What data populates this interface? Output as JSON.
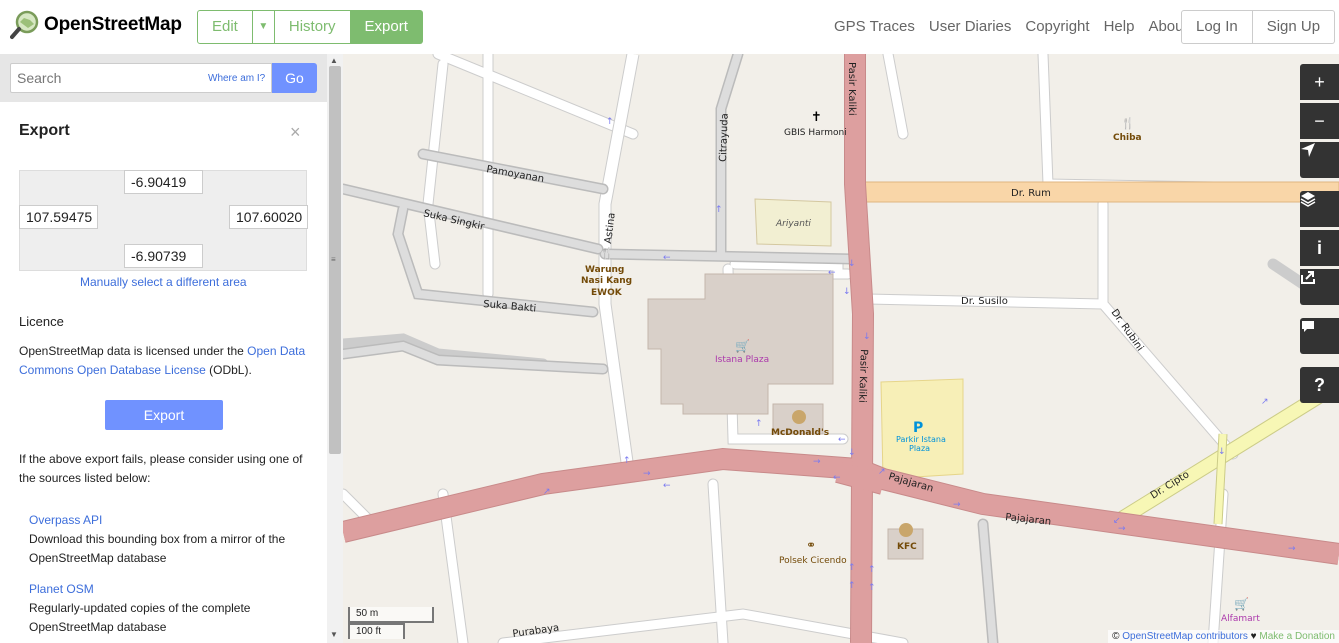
{
  "header": {
    "title": "OpenStreetMap",
    "edit_label": "Edit",
    "history_label": "History",
    "export_label": "Export",
    "nav": [
      "GPS Traces",
      "User Diaries",
      "Copyright",
      "Help",
      "About"
    ],
    "login_label": "Log In",
    "signup_label": "Sign Up"
  },
  "search": {
    "placeholder": "Search",
    "where_am_i": "Where am I?",
    "go_label": "Go"
  },
  "export": {
    "title": "Export",
    "close": "×",
    "bbox": {
      "top": "-6.90419",
      "left": "107.59475",
      "right": "107.60020",
      "bottom": "-6.90739"
    },
    "manual_select": "Manually select a different area",
    "licence_heading": "Licence",
    "licence_pre": "OpenStreetMap data is licensed under the ",
    "licence_link": "Open Data Commons Open Database License",
    "licence_post": " (ODbL).",
    "export_button": "Export",
    "fail_text": "If the above export fails, please consider using one of the sources listed below:",
    "sources": [
      {
        "name": "Overpass API",
        "desc": "Download this bounding box from a mirror of the OpenStreetMap database"
      },
      {
        "name": "Planet OSM",
        "desc": "Regularly-updated copies of the complete OpenStreetMap database"
      }
    ]
  },
  "map": {
    "streets": {
      "pasir_kaliki": "Pasir Kaliki",
      "dr_rum": "Dr. Rum",
      "dr_susilo": "Dr. Susilo",
      "dr_rubini": "Dr. Rubini",
      "dr_cipto": "Dr. Cipto",
      "pajajaran": "Pajajaran",
      "pamoyanan": "Pamoyanan",
      "suka_singkir": "Suka Singkir",
      "suka_bakti": "Suka Bakti",
      "astina": "Astina",
      "citrayuda": "Citrayuda",
      "purabaya": "Purabaya"
    },
    "pois": {
      "gbis": "GBIS Harmoni",
      "chiba": "Chiba",
      "ariyanti": "Ariyanti",
      "warung_1": "Warung",
      "warung_2": "Nasi Kang",
      "warung_3": "EWOK",
      "istana_plaza": "Istana Plaza",
      "mcdonalds": "McDonald's",
      "parkir_1": "Parkir Istana",
      "parkir_2": "Plaza",
      "kfc": "KFC",
      "polsek": "Polsek Cicendo",
      "alfamart": "Alfamart"
    },
    "scale_m": "50 m",
    "scale_ft": "100 ft",
    "attribution_prefix": "© ",
    "attribution_link": "OpenStreetMap contributors",
    "attribution_heart": " ♥ ",
    "attribution_donate": "Make a Donation",
    "controls": {
      "zoom_in": "+",
      "zoom_out": "−",
      "info": "i",
      "help": "?"
    }
  }
}
